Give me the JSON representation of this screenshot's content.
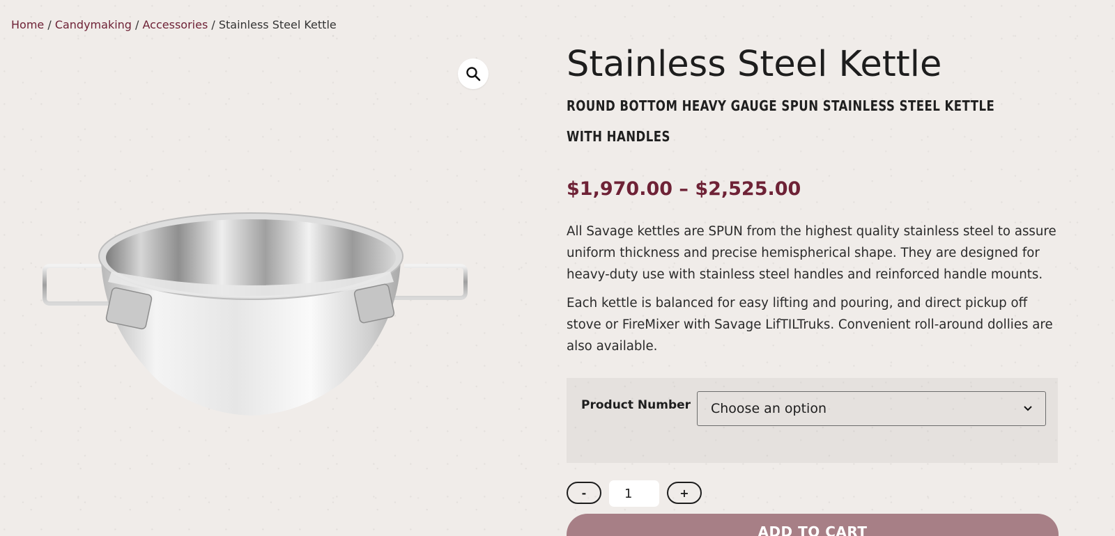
{
  "breadcrumb": {
    "home": "Home",
    "category": "Candymaking",
    "subcategory": "Accessories",
    "current": "Stainless Steel Kettle",
    "separator": " / "
  },
  "gallery": {
    "zoom_icon": "magnifier-icon",
    "image_alt": "Stainless steel kettle with handles"
  },
  "product": {
    "title": "Stainless Steel Kettle",
    "subtitle": "ROUND BOTTOM HEAVY GAUGE SPUN STAINLESS STEEL KETTLE WITH HANDLES",
    "price": "$1,970.00 – $2,525.00",
    "description": [
      "All Savage kettles are SPUN from the highest quality stainless steel to assure uniform thickness and precise hemispherical shape. They are designed for heavy-duty use with stainless steel handles and reinforced handle mounts.",
      "Each kettle is balanced for easy lifting and pouring, and direct pickup off stove or FireMixer with Savage LifTILTruks. Convenient roll-around dollies are also available."
    ]
  },
  "variations": {
    "label": "Product Number",
    "selected": "Choose an option"
  },
  "quantity": {
    "minus": "-",
    "value": "1",
    "plus": "+"
  },
  "cart": {
    "label": "ADD TO CART"
  },
  "colors": {
    "accent": "#6e2236",
    "button": "#a77f86",
    "background": "#f0ece9"
  }
}
